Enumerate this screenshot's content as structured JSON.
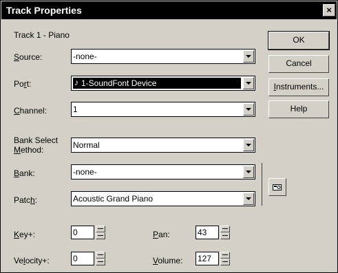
{
  "window": {
    "title": "Track Properties",
    "close_glyph": "×"
  },
  "track_label": "Track 1 - Piano",
  "fields": {
    "source": {
      "label_prefix": "",
      "label_mn": "S",
      "label_rest": "ource:",
      "value": "-none-"
    },
    "port": {
      "label_prefix": "Po",
      "label_mn": "r",
      "label_rest": "t:",
      "value": "1-SoundFont Device",
      "icon": "music-note-icon"
    },
    "channel": {
      "label_prefix": "",
      "label_mn": "C",
      "label_rest": "hannel:",
      "value": "1"
    },
    "bank_select": {
      "label_line1": "Bank Select",
      "label_line2_mn": "M",
      "label_line2_rest": "ethod:",
      "value": "Normal"
    },
    "bank": {
      "label_prefix": "",
      "label_mn": "B",
      "label_rest": "ank:",
      "value": "-none-"
    },
    "patch": {
      "label_prefix": "Patc",
      "label_mn": "h",
      "label_rest": ":",
      "value": "Acoustic Grand Piano"
    }
  },
  "buttons": {
    "ok": "OK",
    "cancel": "Cancel",
    "instruments_mn": "I",
    "instruments_rest": "nstruments...",
    "help": "Help"
  },
  "spinners": {
    "key": {
      "label_mn": "K",
      "label_rest": "ey+:",
      "value": "0"
    },
    "velocity": {
      "label_prefix": "Ve",
      "label_mn": "l",
      "label_rest": "ocity+:",
      "value": "0"
    },
    "pan": {
      "label_mn": "P",
      "label_rest": "an:",
      "value": "43"
    },
    "volume": {
      "label_mn": "V",
      "label_rest": "olume:",
      "value": "127"
    }
  },
  "colors": {
    "face": "#d4d0c8",
    "titlebar": "#000000",
    "selection": "#000000"
  }
}
